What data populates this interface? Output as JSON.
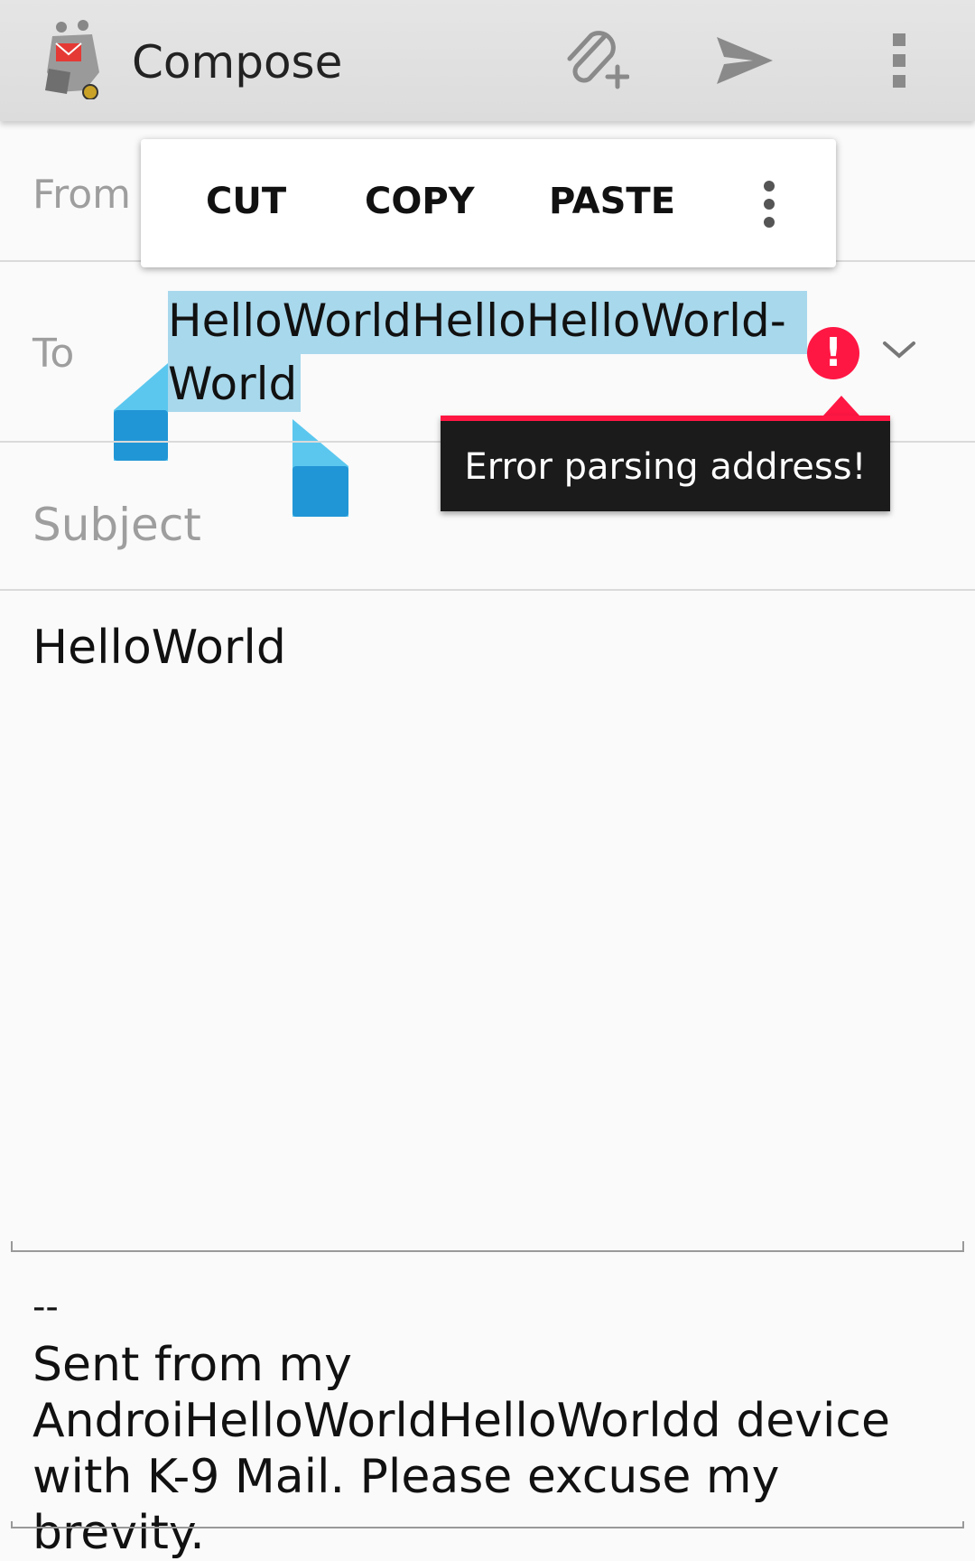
{
  "app_bar": {
    "title": "Compose",
    "icons": [
      "k9-dog-icon",
      "attach-icon",
      "send-icon",
      "overflow-menu-icon"
    ]
  },
  "context_menu": {
    "cut": "CUT",
    "copy": "COPY",
    "paste": "PASTE",
    "more_icon": "more-vert-icon"
  },
  "form": {
    "from_label": "From",
    "to_label": "To",
    "to_value_line1": "HelloWorldHelloHelloWorld-",
    "to_value_line2": "World",
    "subject_label": "Subject"
  },
  "error": {
    "message": "Error parsing address!",
    "icon_glyph": "!",
    "color": "#ff1744"
  },
  "message": {
    "body": "HelloWorld",
    "sig_dashes": "--",
    "signature": "Sent from my AndroiHelloWorldHelloWorldd device with K-9 Mail. Please excuse my brevity."
  },
  "colors": {
    "selection": "#a8d8ec",
    "handle": "#2196d6",
    "accent": "#ff1744"
  }
}
